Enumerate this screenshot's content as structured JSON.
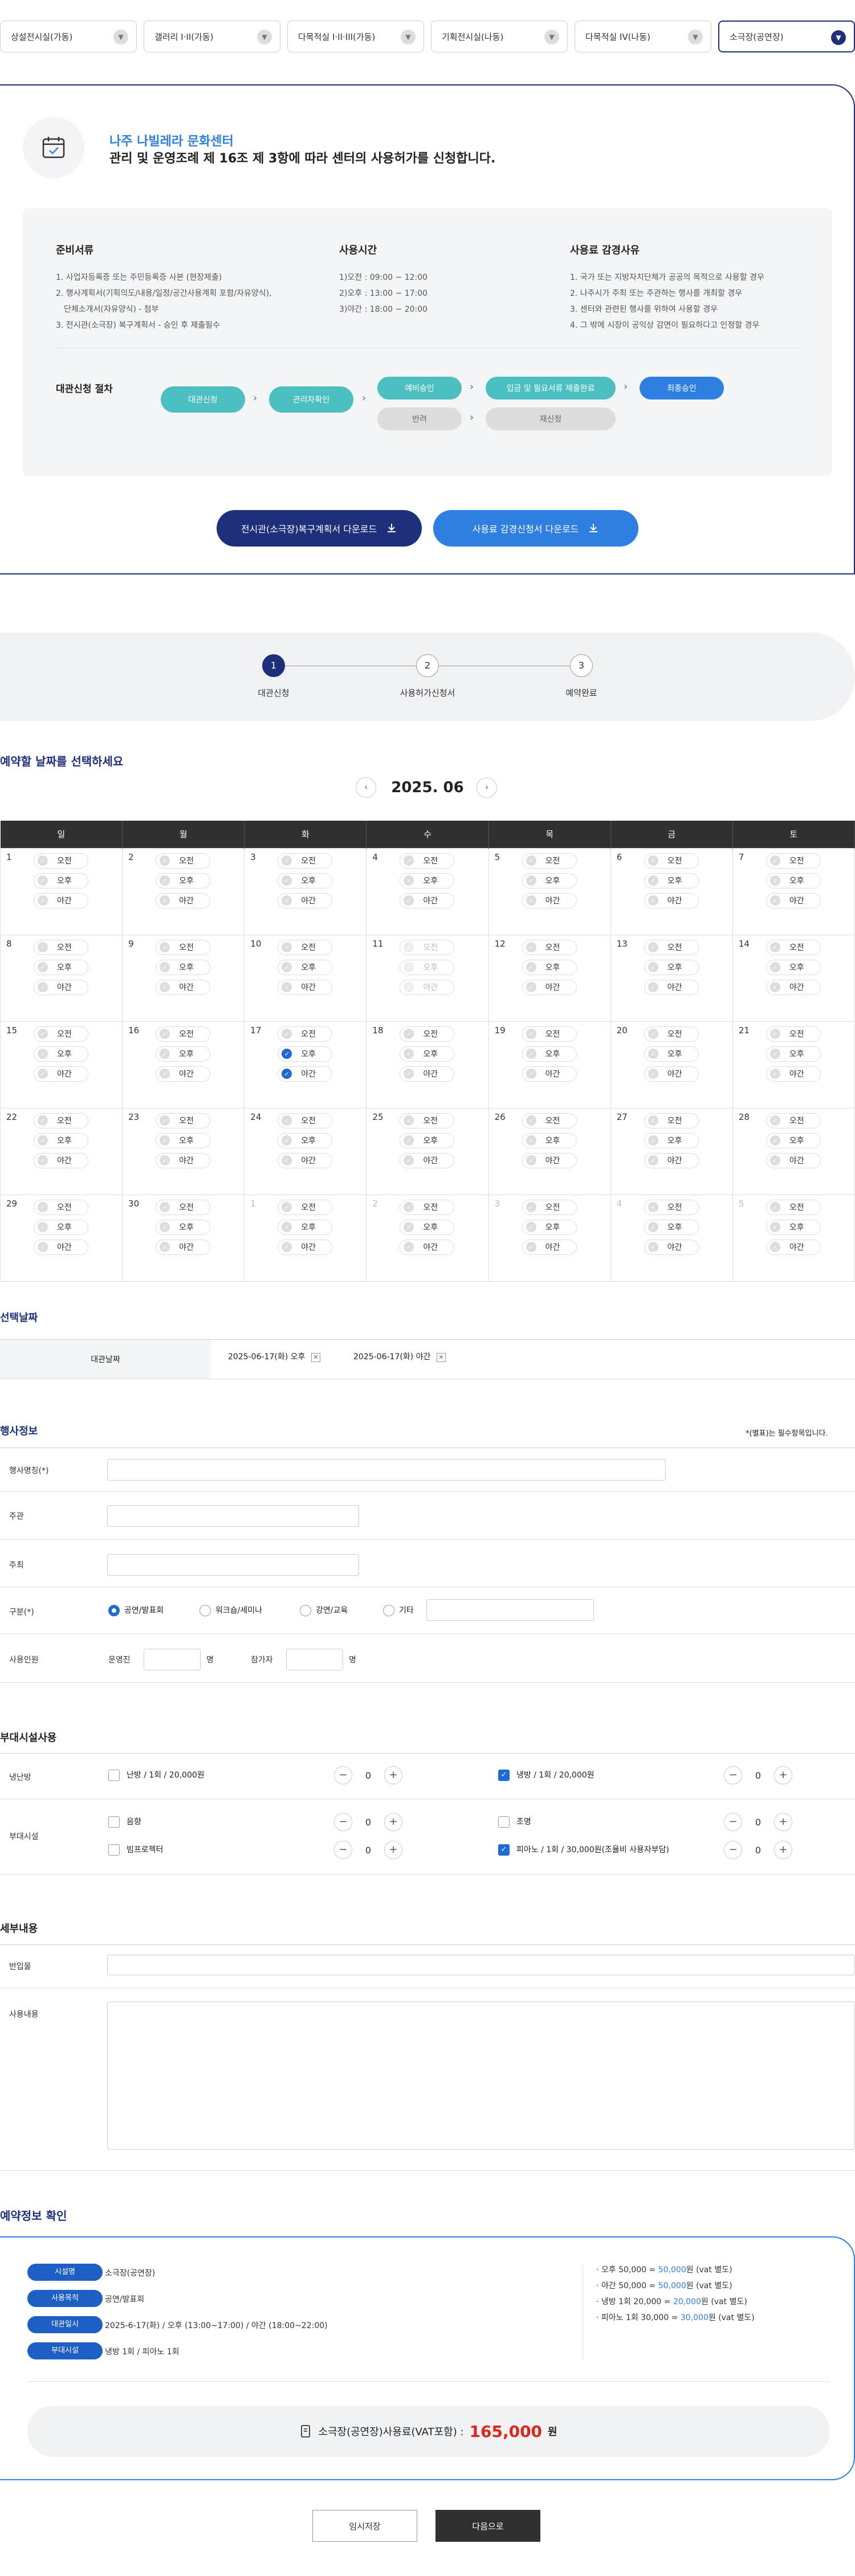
{
  "tabs": [
    {
      "label": "상설전시실(가동)"
    },
    {
      "label": "갤러리 I·II(가동)"
    },
    {
      "label": "다목적실 I·II·III(가동)"
    },
    {
      "label": "기획전시실(나동)"
    },
    {
      "label": "다목적실 IV(나동)"
    },
    {
      "label": "소극장(공연장)"
    }
  ],
  "intro": {
    "title": "나주 나빌레라 문화센터",
    "subtitle": "관리 및 운영조례 제 16조 제 3항에 따라 센터의 사용허가를 신청합니다."
  },
  "info": {
    "docs_title": "준비서류",
    "docs": [
      "1. 사업자등록증 또는 주민등록증 사본 (현장제출)",
      "2. 행사계획서(기획의도/내용/일정/공간사용계획 포함/자유양식),",
      "    단체소개서(자유양식) - 첨부",
      "3. 전시관(소극장) 복구계획서 - 승인 후 제출필수"
    ],
    "time_title": "사용시간",
    "times": [
      "1)오전 : 09:00 ~ 12:00",
      "2)오후 : 13:00 ~ 17:00",
      "3)야간 : 18:00 ~ 20:00"
    ],
    "discount_title": "사용료 감경사유",
    "discounts": [
      "1. 국가 또는 지방자치단체가 공공의 목적으로 사용할 경우",
      "2. 나주시가 주최 또는 주관하는 행사를 개최할 경우",
      "3. 센터와 관련된 행사를 위하여 사용할 경우",
      "4. 그 밖에 시장이 공익상 감면이 필요하다고 인정할 경우"
    ],
    "process_title": "대관신청 절차",
    "steps": {
      "s1": "대관신청",
      "s2": "관리자확인",
      "s3": "예비승인",
      "s3b": "반려",
      "s4": "입금 및 필요서류 제출완료",
      "s4b": "재신청",
      "s5": "최종승인"
    }
  },
  "downloads": {
    "d1": "전시관(소극장)복구계획서 다운로드",
    "d2": "사용료 감경신청서 다운로드"
  },
  "progress": [
    {
      "num": "1",
      "label": "대관신청"
    },
    {
      "num": "2",
      "label": "사용허가신청서"
    },
    {
      "num": "3",
      "label": "예약완료"
    }
  ],
  "calendar": {
    "heading": "예약할 날짜를 선택하세요",
    "month": "2025. 06",
    "weekdays": [
      "일",
      "월",
      "화",
      "수",
      "목",
      "금",
      "토"
    ],
    "slot_labels": [
      "오전",
      "오후",
      "야간"
    ]
  },
  "selected": {
    "heading": "선택날짜",
    "label": "대관날짜",
    "dates": [
      "2025-06-17(화) 오후",
      "2025-06-17(화) 야간"
    ]
  },
  "event": {
    "heading": "행사정보",
    "required_note": "*(별표)는 필수항목입니다.",
    "name_label": "행사명칭(*)",
    "host_label": "주관",
    "organizer_label": "주최",
    "type_label": "구분(*)",
    "types": [
      "공연/발표회",
      "워크숍/세미나",
      "강연/교육",
      "기타"
    ],
    "people_label": "사용인원",
    "staff_label": "운영진",
    "guest_label": "참가자",
    "unit": "명"
  },
  "facilities": {
    "heading": "부대시설사용",
    "hvac_label": "냉난방",
    "heating": "난방 / 1회 / 20,000원",
    "cooling": "냉방 / 1회 / 20,000원",
    "heating_qty": "0",
    "cooling_qty": "0",
    "extra_label": "부대시설",
    "sound": "음향",
    "lighting": "조명",
    "projector": "빔프로젝터",
    "piano": "피아노 / 1회 / 30,000원(조율비 사용자부담)",
    "sound_qty": "0",
    "lighting_qty": "0",
    "projector_qty": "0",
    "piano_qty": "0"
  },
  "details": {
    "heading": "세부내용",
    "entry_label": "반입물",
    "usage_label": "사용내용"
  },
  "summary": {
    "heading": "예약정보 확인",
    "rows": [
      {
        "tag": "시설명",
        "value": "소극장(공연장)"
      },
      {
        "tag": "사용목적",
        "value": "공연/발표회"
      },
      {
        "tag": "대관일시",
        "value": "2025-6-17(화) / 오후 (13:00~17:00) / 야간 (18:00~22:00)"
      },
      {
        "tag": "부대시설",
        "value": "냉방 1회  /  피아노 1회"
      }
    ],
    "fees": [
      {
        "pre": "오후 50,000 = ",
        "amt": "50,000",
        "post": "원 (vat 별도)"
      },
      {
        "pre": "야간 50,000 = ",
        "amt": "50,000",
        "post": "원 (vat 별도)"
      },
      {
        "pre": "냉방 1회 20,000 = ",
        "amt": "20,000",
        "post": "원 (vat 별도)"
      },
      {
        "pre": "피아노 1회 30,000 = ",
        "amt": "30,000",
        "post": "원 (vat 별도)"
      }
    ],
    "total_label": "소극장(공연장)사용료(VAT포함) :",
    "total_amount": "165,000",
    "total_unit": "원"
  },
  "buttons": {
    "save": "임시저장",
    "next": "다음으로"
  },
  "colors": {
    "navy": "#1e2f7c",
    "teal": "#4cbfc0",
    "blue": "#2e7fe0",
    "red": "#e2231a"
  }
}
